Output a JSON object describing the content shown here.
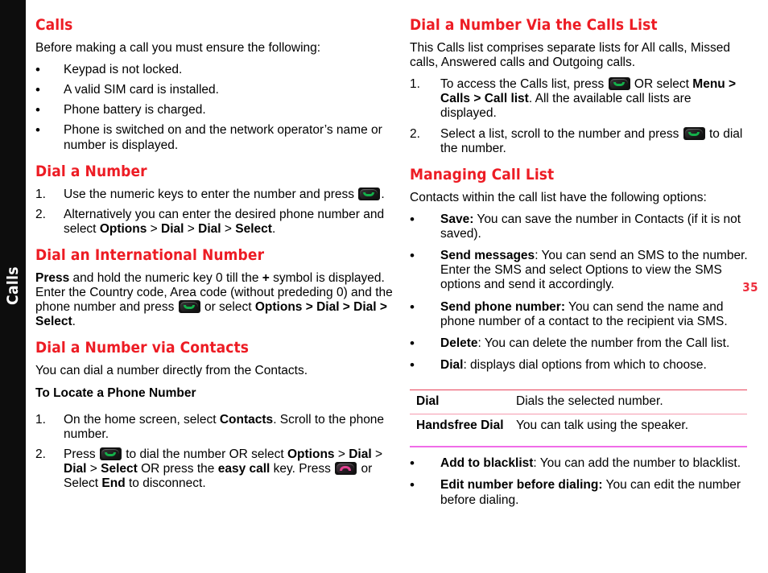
{
  "side_tab": {
    "label": "Calls"
  },
  "page_number": "35",
  "colors": {
    "heading_red": "#ED1C24",
    "page_number_red": "#ED2F3E",
    "tab_background": "#0D0D0D",
    "tab_text": "#FFFFFF",
    "rule_top": "#E8435B",
    "rule_mid": "#F59AAE",
    "rule_bottom": "#F06CE8",
    "call_key_green": "#14B04A",
    "end_key_pink": "#E0408F"
  },
  "icons": {
    "call_key": "green-call-key-icon",
    "end_key": "red-end-call-key-icon"
  },
  "left_column": {
    "calls": {
      "heading": "Calls",
      "intro": "Before making a call you must ensure the following:",
      "bullets": [
        "Keypad is not locked.",
        "A valid SIM card is installed.",
        "Phone battery is charged.",
        "Phone is switched on and the network operator’s name or number is displayed."
      ]
    },
    "dial_a_number": {
      "heading": "Dial a Number",
      "step1_a": "Use the numeric keys to enter the number and press",
      "step1_b": ".",
      "step2_a": "Alternatively you can enter the desired phone number and select ",
      "step2_options": "Options",
      "step2_sep1": " > ",
      "step2_dial1": "Dial",
      "step2_sep2": " > ",
      "step2_dial2": "Dial",
      "step2_sep3": " > ",
      "step2_select": "Select",
      "step2_end": "."
    },
    "dial_international": {
      "heading": "Dial an International Number",
      "press": "Press",
      "text_a": " and hold the numeric key 0 till the ",
      "plus": "+",
      "text_b": " symbol is displayed. Enter the Country code, Area code (without prededing 0) and the phone number and press",
      "text_c": " or select ",
      "options_path": "Options > Dial > Dial > Select",
      "text_d": "."
    },
    "dial_via_contacts": {
      "heading": "Dial a Number via Contacts",
      "intro": "You can dial a number directly from the Contacts.",
      "subhead": "To Locate a Phone Number",
      "step1_a": "On the home screen, select ",
      "step1_contacts": "Contacts",
      "step1_b": ". Scroll to the phone number.",
      "step2_press": "Press",
      "step2_a": " to dial the number OR select ",
      "step2_options": "Options",
      "step2_b": " > ",
      "step2_dial1": "Dial",
      "step2_c": " > ",
      "step2_dial2": "Dial",
      "step2_d": " > ",
      "step2_select": "Select",
      "step2_e": " OR press the ",
      "step2_easycall": "easy call",
      "step2_f": " key. Press",
      "step2_g": " or Select ",
      "step2_end": "End",
      "step2_h": " to disconnect."
    }
  },
  "right_column": {
    "dial_via_calls_list": {
      "heading": "Dial a Number Via the Calls List",
      "intro": "This Calls list comprises separate lists for All calls, Missed calls, Answered calls and Outgoing calls.",
      "step1_a": "To access the Calls list, press",
      "step1_b": " OR select ",
      "step1_menu": "Menu > Calls > Call list",
      "step1_c": ". All the available call lists are displayed.",
      "step2_a": "Select a list, scroll to the number and press",
      "step2_b": " to dial the number."
    },
    "managing_call_list": {
      "heading": "Managing Call List",
      "intro": "Contacts within the call list have the following options:",
      "bullets": [
        {
          "term": "Save:",
          "desc": " You can save the number in Contacts (if it is not saved)."
        },
        {
          "term": "Send messages",
          "desc": ": You can send an SMS to the number. Enter the SMS and select Options to view the SMS options and send it accordingly."
        },
        {
          "term": "Send phone number:",
          "desc": " You can send the name and phone number of a contact to the recipient via SMS."
        },
        {
          "term": "Delete",
          "desc": ": You can delete the number from the Call list."
        },
        {
          "term": "Dial",
          "desc": ": displays dial options from which to choose."
        }
      ],
      "table": {
        "rows": [
          {
            "option": "Dial",
            "description": "Dials the selected number."
          },
          {
            "option": "Handsfree Dial",
            "description": "You can talk using the speaker."
          }
        ]
      },
      "bullets_after": [
        {
          "term": "Add to blacklist",
          "desc": ": You can add the number to blacklist."
        },
        {
          "term": "Edit number before dialing:",
          "desc": " You can edit the number before dialing."
        }
      ]
    }
  },
  "markers": {
    "bullet": "•",
    "n1": "1.",
    "n2": "2."
  }
}
